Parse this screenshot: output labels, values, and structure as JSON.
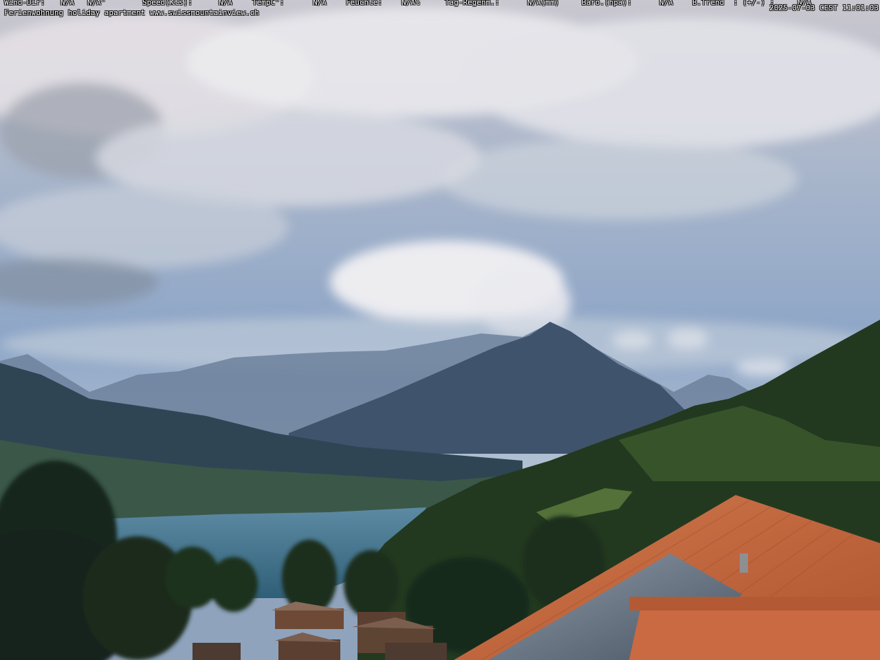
{
  "overlay": {
    "wind_dir_label": "Wind-Dir:",
    "wind_dir_value": "N/A",
    "wind_dir_deg": "N/A°",
    "speed_label": "Speed(Kts):",
    "speed_value": "N/A",
    "temp_label": "TempC°:",
    "temp_value": "N/A",
    "humidity_label": "Feuchte:",
    "humidity_value": "N/A%",
    "rain_label": "Tag-Regenm.:",
    "rain_value": "N/A(mm)",
    "baro_label": "Baro.(hpa):",
    "baro_value": "N/A",
    "trend_label": "B.Trend  : (+/-) :",
    "trend_value": "N/A",
    "caption": "Ferienwohnung holiday apartment www.swissmountainview.ch",
    "timestamp": "2025-07-03 CEST 11:01:03"
  },
  "colors": {
    "sky_top": "#9aaac4",
    "sky_bottom": "#b9c7d6",
    "mountain": "#3d506a",
    "lake": "#3f6f8a",
    "forest": "#1f3420",
    "roof": "#c76a43"
  }
}
